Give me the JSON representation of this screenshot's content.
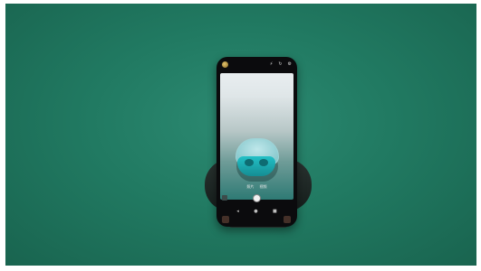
{
  "scene": {
    "background_color": "#217a62",
    "subject": "smartphone on stand"
  },
  "phone": {
    "status_icons": [
      "flash-icon",
      "timer-icon",
      "settings-icon"
    ],
    "mode_labels": [
      "照片",
      "视频"
    ],
    "nav_icons": [
      "back-icon",
      "home-icon",
      "recents-icon"
    ],
    "preview_subject": "earbud-case"
  }
}
